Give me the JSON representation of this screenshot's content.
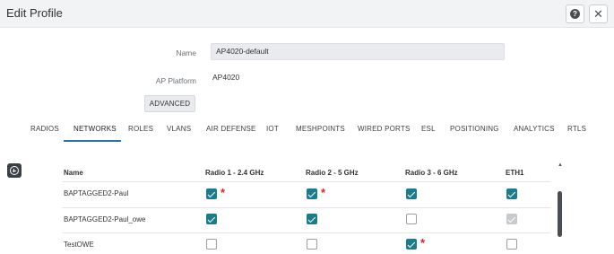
{
  "header": {
    "title": "Edit Profile",
    "help_icon_glyph": "?",
    "close_icon_glyph": "✕"
  },
  "form": {
    "name_label": "Name",
    "name_value": "AP4020-default",
    "platform_label": "AP Platform",
    "platform_value": "AP4020",
    "advanced_label": "ADVANCED"
  },
  "tabs": [
    "RADIOS",
    "NETWORKS",
    "ROLES",
    "VLANS",
    "AIR DEFENSE",
    "IOT",
    "MESHPOINTS",
    "WIRED PORTS",
    "ESL",
    "POSITIONING",
    "ANALYTICS",
    "RTLS"
  ],
  "active_tab": "NETWORKS",
  "table": {
    "columns": [
      "Name",
      "Radio 1 - 2.4 GHz",
      "Radio 2 - 5 GHz",
      "Radio 3 - 6 GHz",
      "ETH1"
    ],
    "rows": [
      {
        "name": "BAPTAGGED2-Paul",
        "radio1": "checked",
        "radio1_required": true,
        "radio2": "checked",
        "radio2_required": true,
        "radio3": "checked",
        "radio3_required": false,
        "eth1": "checked"
      },
      {
        "name": "BAPTAGGED2-Paul_owe",
        "radio1": "checked",
        "radio1_required": false,
        "radio2": "checked",
        "radio2_required": false,
        "radio3": "unchecked",
        "radio3_required": false,
        "eth1": "disabled-checked"
      },
      {
        "name": "TestOWE",
        "radio1": "unchecked",
        "radio1_required": false,
        "radio2": "unchecked",
        "radio2_required": false,
        "radio3": "checked",
        "radio3_required": true,
        "eth1": "unchecked"
      }
    ],
    "required_marker": "*"
  },
  "colors": {
    "accent": "#1c7c8f",
    "tab_underline": "#2a6fb0",
    "required": "#e02020",
    "header_bg": "#f2f3f5"
  },
  "icons": {
    "help": "help-icon",
    "close": "close-icon",
    "add": "add-circle-icon",
    "scroll_up": "scroll-up-arrow-icon"
  }
}
